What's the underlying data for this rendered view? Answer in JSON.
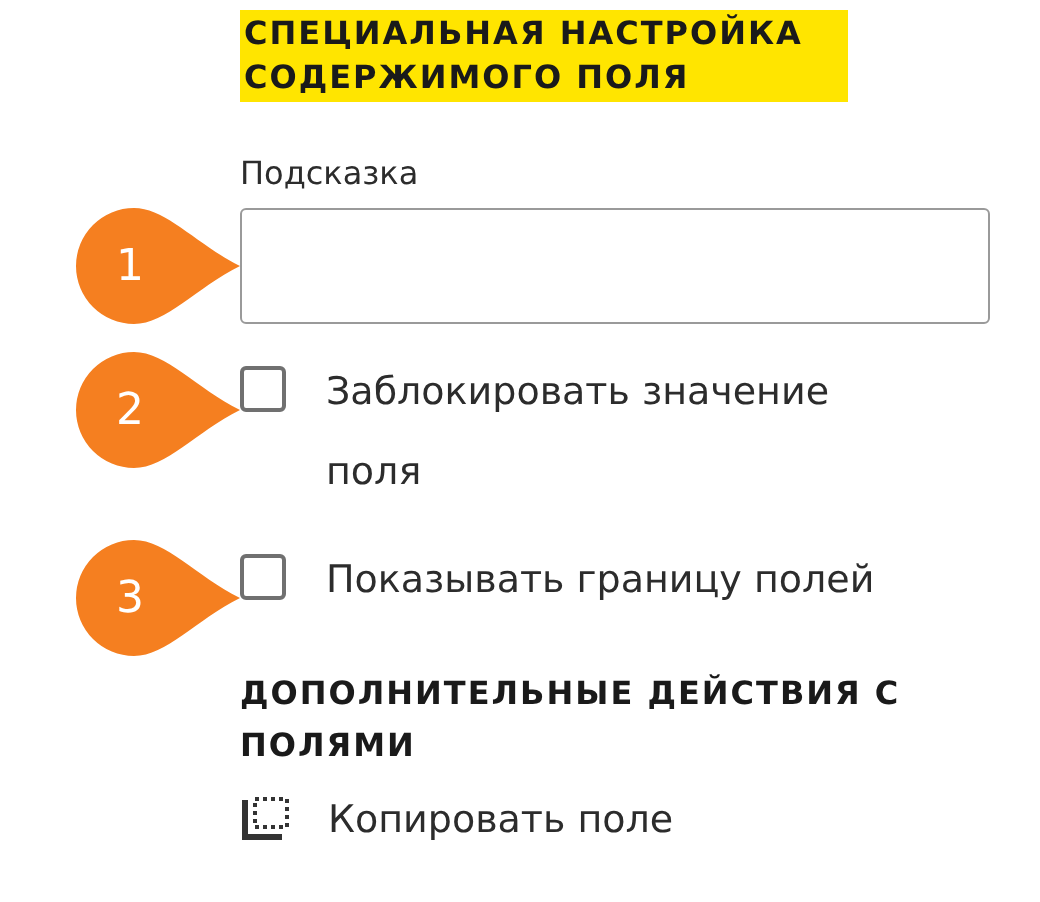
{
  "custom_section": {
    "title": "СПЕЦИАЛЬНАЯ НАСТРОЙКА СОДЕРЖИМОГО ПОЛЯ",
    "hint_label": "Подсказка",
    "hint_marker": "1",
    "options": [
      {
        "marker": "2",
        "label": "Заблокировать значение поля",
        "checked": false
      },
      {
        "marker": "3",
        "label": "Показывать границу полей",
        "checked": false
      }
    ]
  },
  "actions_section": {
    "title": "ДОПОЛНИТЕЛЬНЫЕ ДЕЙСТВИЯ С ПОЛЯМИ",
    "items": [
      {
        "label": "Копировать поле"
      }
    ]
  }
}
